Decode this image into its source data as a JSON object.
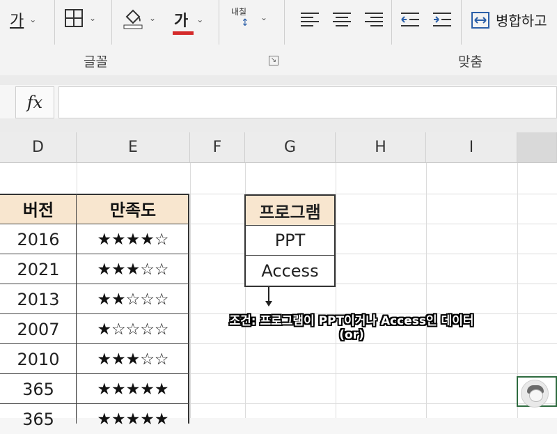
{
  "ribbon": {
    "font_char": "가",
    "font_color_char": "가",
    "wrap_text_top": "내칠",
    "merge_label": "병합하고",
    "font_group_label": "글꼴",
    "align_group_label": "맞춤",
    "font_color_hex": "#d42a2a"
  },
  "formula_bar": {
    "fx_label": "fx",
    "value": ""
  },
  "columns": [
    "D",
    "E",
    "F",
    "G",
    "H",
    "I"
  ],
  "data_table": {
    "headers": {
      "version": "버전",
      "satisfaction": "만족도"
    },
    "rows": [
      {
        "version": "2016",
        "stars": "★★★★☆"
      },
      {
        "version": "2021",
        "stars": "★★★☆☆"
      },
      {
        "version": "2013",
        "stars": "★★☆☆☆"
      },
      {
        "version": "2007",
        "stars": "★☆☆☆☆"
      },
      {
        "version": "2010",
        "stars": "★★★☆☆"
      },
      {
        "version": "365",
        "stars": "★★★★★"
      },
      {
        "version": "365",
        "stars": "★★★★★"
      }
    ],
    "header_fill": "#f8e6cf"
  },
  "criteria_table": {
    "header": "프로그램",
    "values": [
      "PPT",
      "Access"
    ]
  },
  "caption": {
    "line1": "조건: 프로그램이 PPT이거나 Access인 데이터",
    "line2": "(or)"
  }
}
